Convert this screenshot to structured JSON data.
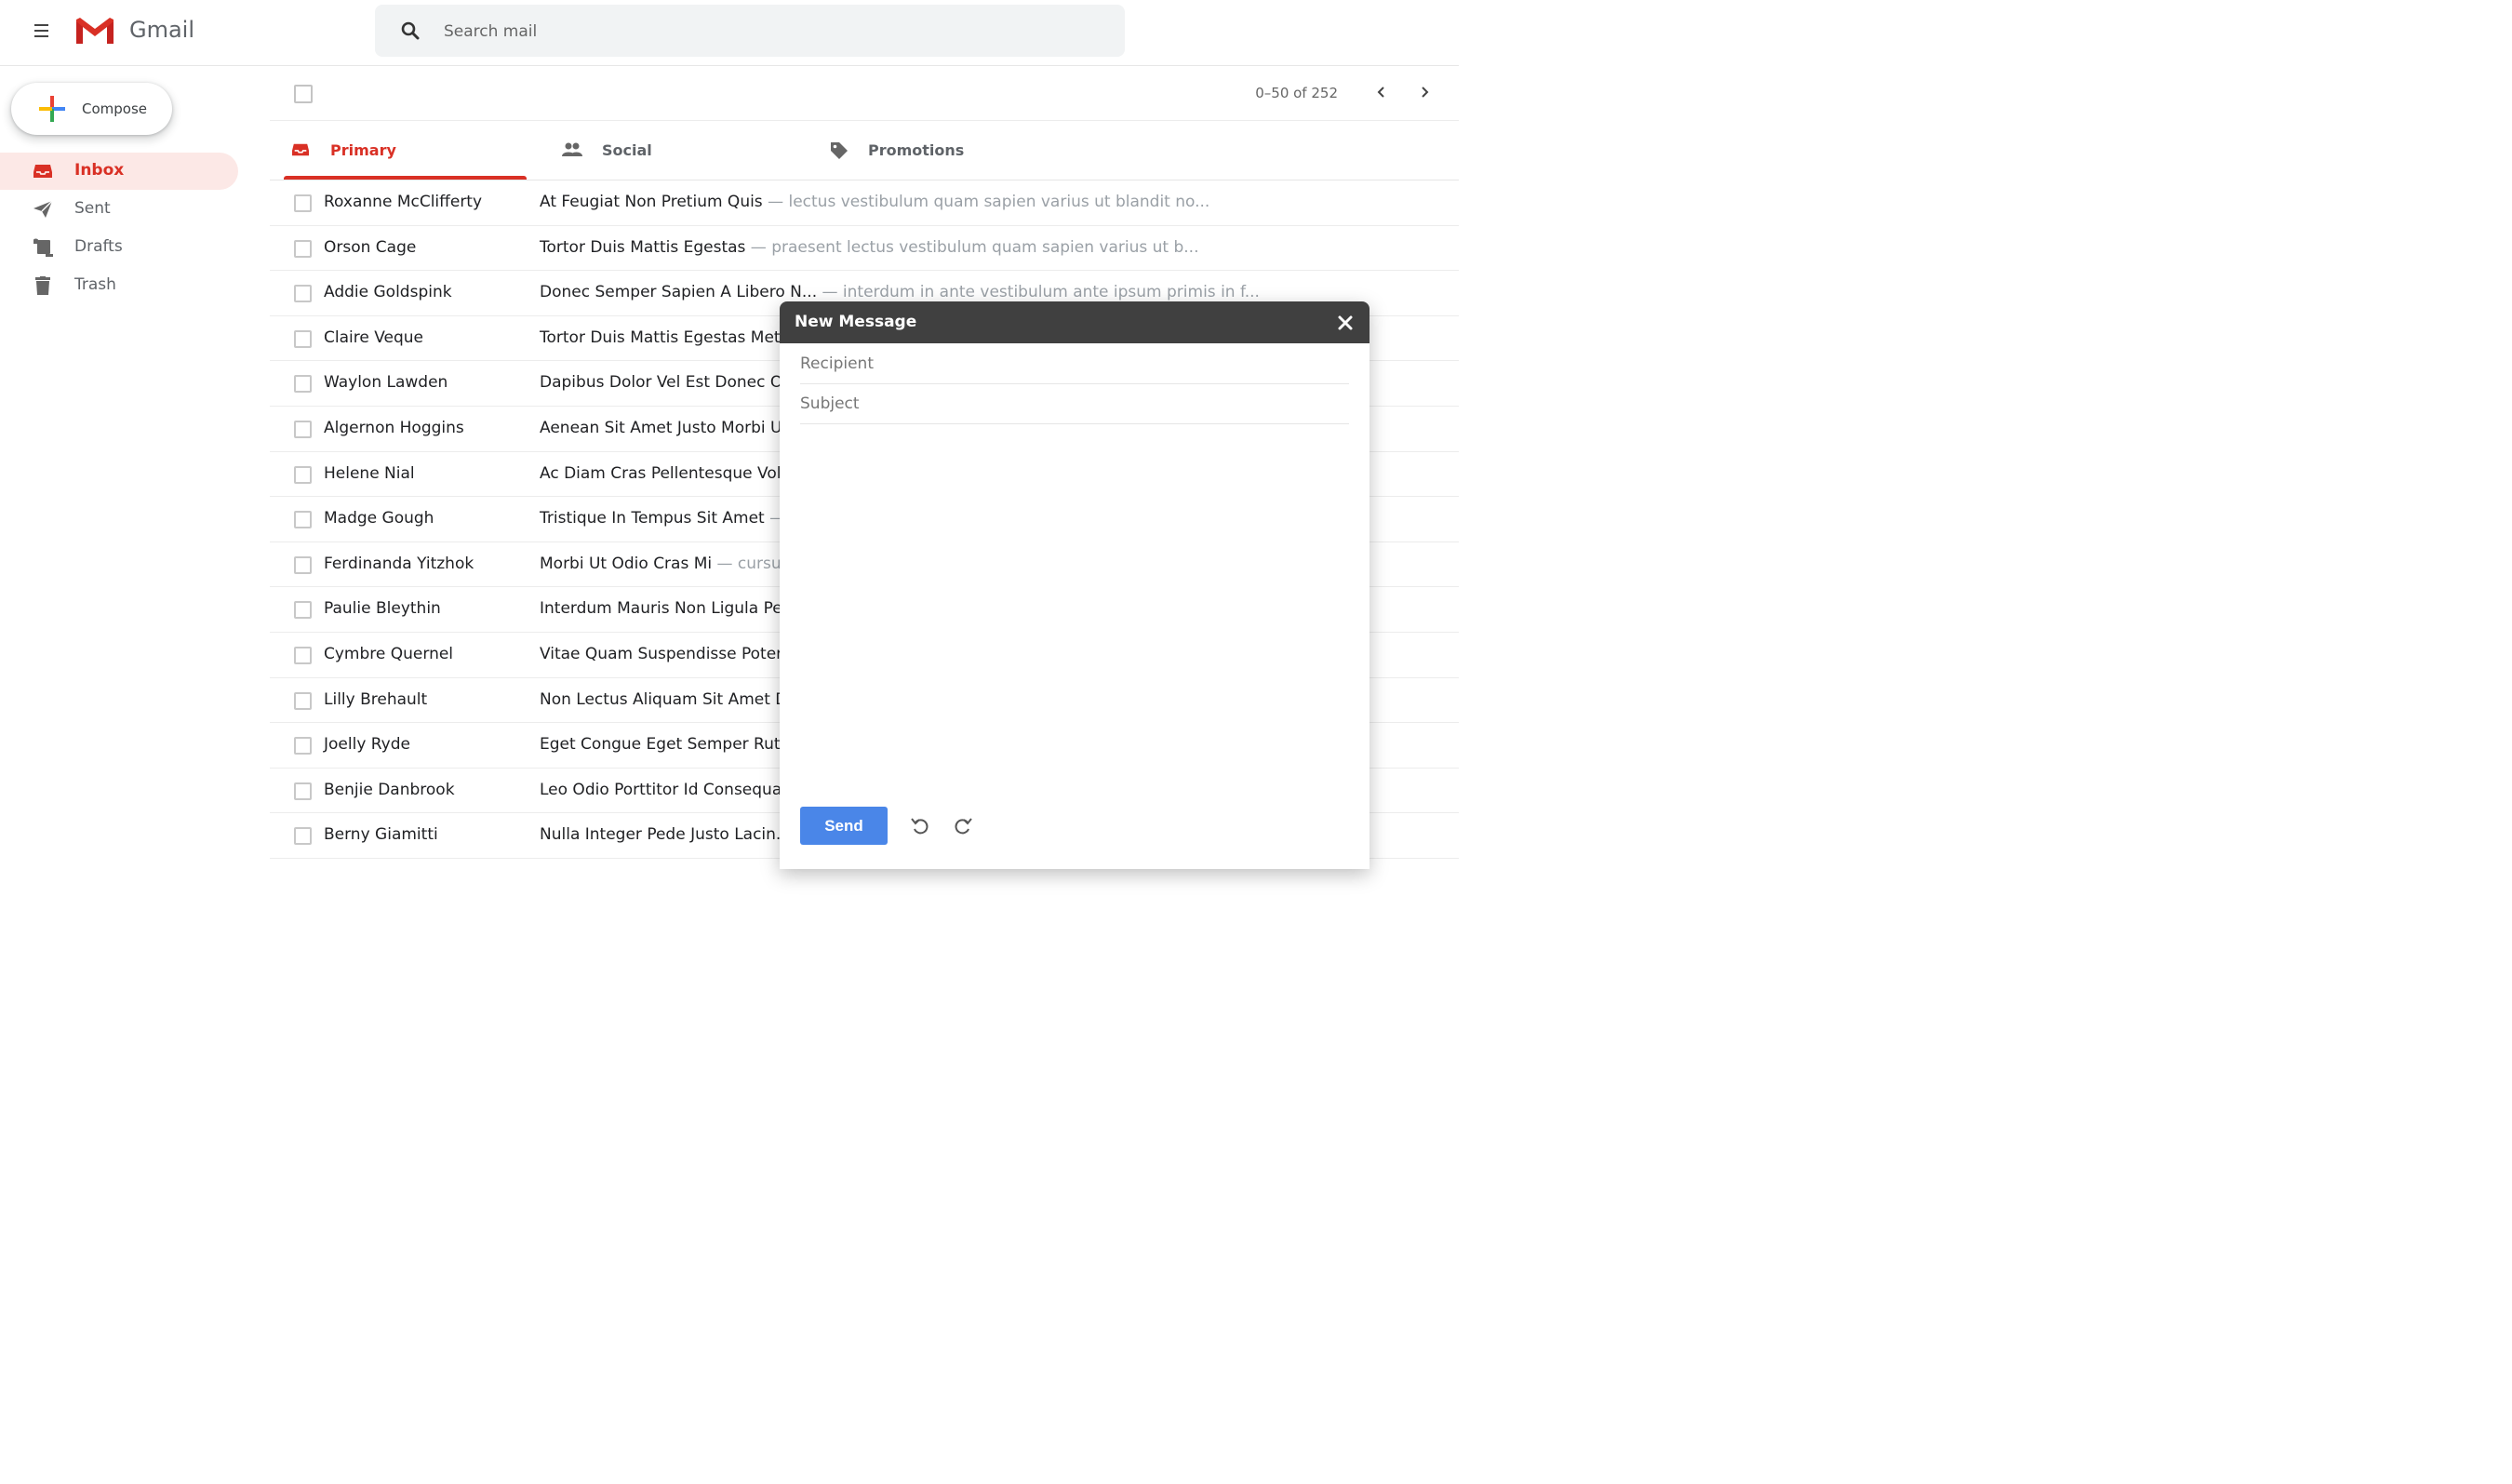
{
  "header": {
    "app_name": "Gmail",
    "search_placeholder": "Search mail"
  },
  "sidebar": {
    "compose_label": "Compose",
    "items": [
      {
        "label": "Inbox",
        "icon": "inbox-icon",
        "active": true
      },
      {
        "label": "Sent",
        "icon": "send-icon",
        "active": false
      },
      {
        "label": "Drafts",
        "icon": "drafts-icon",
        "active": false
      },
      {
        "label": "Trash",
        "icon": "trash-icon",
        "active": false
      }
    ]
  },
  "toolbar": {
    "page_count": "0–50 of 252"
  },
  "tabs": [
    {
      "label": "Primary",
      "icon": "inbox-icon",
      "active": true
    },
    {
      "label": "Social",
      "icon": "people-icon",
      "active": false
    },
    {
      "label": "Promotions",
      "icon": "tag-icon",
      "active": false
    }
  ],
  "emails": [
    {
      "sender": "Roxanne McClifferty",
      "subject": "At Feugiat Non Pretium Quis",
      "snippet": " — lectus vestibulum quam sapien varius ut blandit no..."
    },
    {
      "sender": "Orson Cage",
      "subject": "Tortor Duis Mattis Egestas",
      "snippet": " — praesent lectus vestibulum quam sapien varius ut b..."
    },
    {
      "sender": "Addie Goldspink",
      "subject": "Donec Semper Sapien A Libero N...",
      "snippet": " — interdum in ante vestibulum ante ipsum primis in f..."
    },
    {
      "sender": "Claire Veque",
      "subject": "Tortor Duis Mattis Egestas Met",
      "snippet": ""
    },
    {
      "sender": "Waylon Lawden",
      "subject": "Dapibus Dolor Vel Est Donec O",
      "snippet": ""
    },
    {
      "sender": "Algernon Hoggins",
      "subject": "Aenean Sit Amet Justo Morbi U",
      "snippet": ""
    },
    {
      "sender": "Helene Nial",
      "subject": "Ac Diam Cras Pellentesque Vol",
      "snippet": ""
    },
    {
      "sender": "Madge Gough",
      "subject": "Tristique In Tempus Sit Amet",
      "snippet": " —"
    },
    {
      "sender": "Ferdinanda Yitzhok",
      "subject": "Morbi Ut Odio Cras Mi",
      "snippet": " — cursu"
    },
    {
      "sender": "Paulie Bleythin",
      "subject": "Interdum Mauris Non Ligula Pe",
      "snippet": ""
    },
    {
      "sender": "Cymbre Quernel",
      "subject": "Vitae Quam Suspendisse Poter",
      "snippet": ""
    },
    {
      "sender": "Lilly Brehault",
      "subject": "Non Lectus Aliquam Sit Amet D",
      "snippet": ""
    },
    {
      "sender": "Joelly Ryde",
      "subject": "Eget Congue Eget Semper Rutr",
      "snippet": ""
    },
    {
      "sender": "Benjie Danbrook",
      "subject": "Leo Odio Porttitor Id Consequa",
      "snippet": ""
    },
    {
      "sender": "Berny Giamitti",
      "subject": "Nulla Integer Pede Justo Lacin...",
      "snippet": ""
    }
  ],
  "compose_window": {
    "title": "New Message",
    "recipient_placeholder": "Recipient",
    "subject_placeholder": "Subject",
    "send_label": "Send"
  },
  "colors": {
    "accent_red": "#d93025",
    "active_bg": "#fce8e6",
    "send_blue": "#4a86e8",
    "compose_header": "#404040"
  }
}
